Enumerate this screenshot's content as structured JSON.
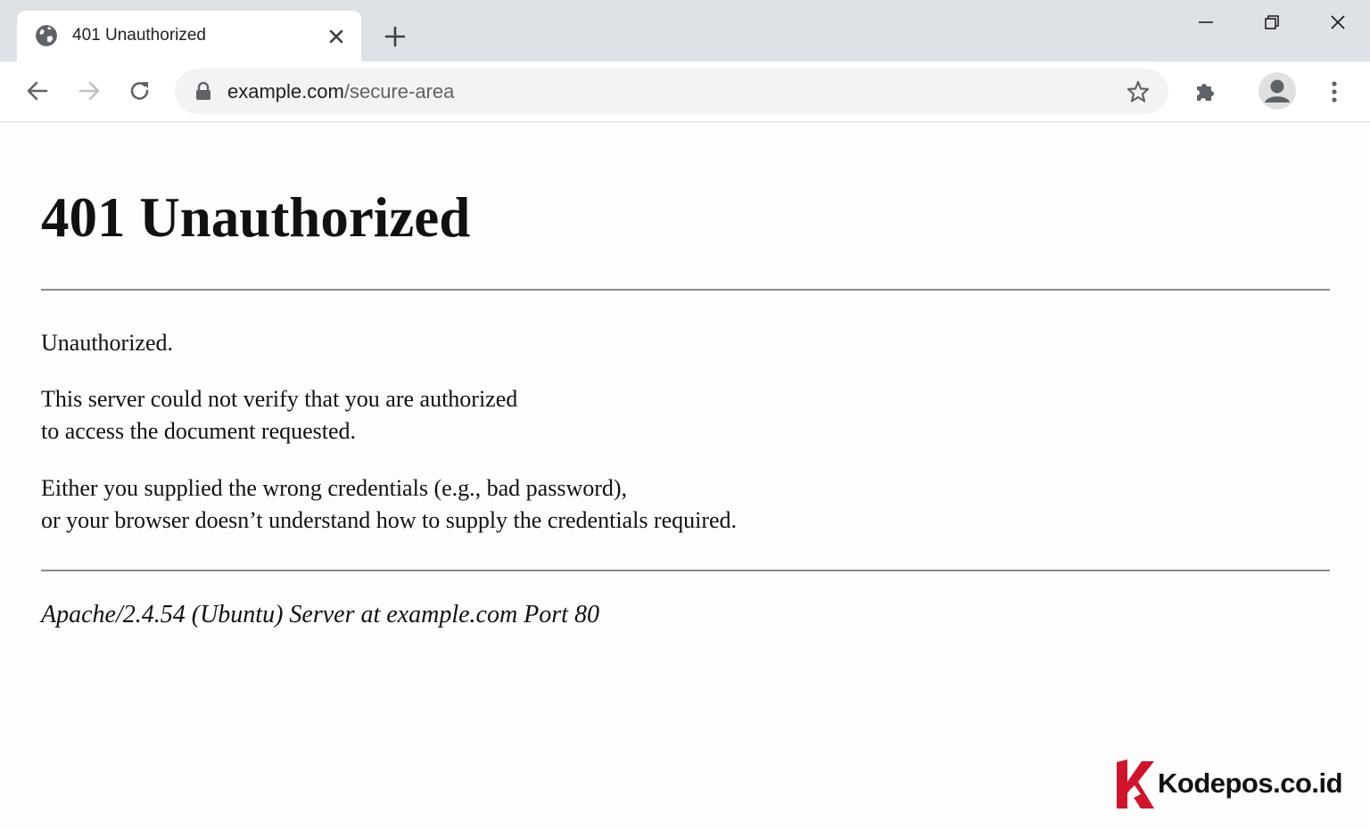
{
  "browser": {
    "tab": {
      "title": "401 Unauthorized"
    },
    "address_bar": {
      "host": "example.com",
      "path": "/secure-area"
    }
  },
  "page": {
    "heading": "401 Unauthorized",
    "paragraph1": "Unauthorized.",
    "paragraph2": [
      "This server could not verify that you are authorized",
      "to access the document requested."
    ],
    "paragraph3": [
      "Either you supplied the wrong credentials (e.g., bad password),",
      "or your browser doesn’t understand how to supply the credentials required."
    ],
    "signature": "Apache/2.4.54 (Ubuntu) Server at example.com Port 80"
  },
  "watermark": {
    "text": "Kodepos.co.id",
    "accent_color": "#d0142c"
  },
  "icons": {
    "tab": "globe-icon",
    "tab_close": "close-icon",
    "new_tab": "plus-icon",
    "back": "arrow-left-icon",
    "forward": "arrow-right-icon",
    "reload": "reload-icon",
    "security": "lock-icon",
    "bookmark": "star-icon",
    "extensions": "puzzle-icon",
    "profile": "person-icon",
    "menu": "kebab-menu-icon"
  },
  "colors": {
    "tabstrip_bg": "#dee1e6",
    "omnibox_bg": "#f1f3f4",
    "page_bg": "#fdfdfd",
    "rule": "#8a8a8a"
  }
}
